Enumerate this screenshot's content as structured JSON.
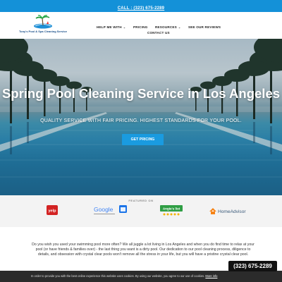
{
  "topbar": {
    "call_text": "CALL : (323) 675-2289"
  },
  "logo": {
    "text": "Tony's Pool & Spa Cleaning Service"
  },
  "nav": {
    "items": [
      {
        "label": "HELP ME WITH",
        "has_dropdown": true
      },
      {
        "label": "PRICING",
        "has_dropdown": false
      },
      {
        "label": "RESOURCES",
        "has_dropdown": true
      },
      {
        "label": "SEE OUR REVIEWS",
        "has_dropdown": false
      },
      {
        "label": "CONTACT US",
        "has_dropdown": false
      }
    ],
    "caret": "⌄"
  },
  "hero": {
    "title": "Spring Pool Cleaning Service in Los Angeles",
    "subtitle": "QUALITY SERVICE WITH FAIR PRICING.  HIGHEST STANDARDS FOR YOUR POOL.",
    "cta_label": "GET PRICING"
  },
  "featured": {
    "label": "FEATURED ON",
    "brands": [
      {
        "name": "yelp",
        "text": "yelp"
      },
      {
        "name": "google-my-business",
        "text": "Google"
      },
      {
        "name": "angies-list",
        "text": "Angie's list"
      },
      {
        "name": "homeadvisor",
        "text": "HomeAdvisor"
      }
    ]
  },
  "intro": {
    "text": "Do you wish you used your swimming pool more often? We all juggle a lot living in Los Angeles and when you do find time to relax at your pool (or have friends & families over) - the last thing you want is a dirty pool. Our dedication to our pool cleaning process, diligence to details, and obsession with crystal clear pools won't remove all the stress in your life, but you will have a pristine crystal clear pool."
  },
  "cookie": {
    "text": "In order to provide you with the best online experience this website uses cookies. By using our website, you agree to our use of cookies.",
    "link": "More info"
  },
  "floating_phone": {
    "text": "(323) 675-2289"
  },
  "colors": {
    "accent": "#1a9be0",
    "topbar": "#1491d8",
    "cookie_bg": "#2b2b2b"
  }
}
